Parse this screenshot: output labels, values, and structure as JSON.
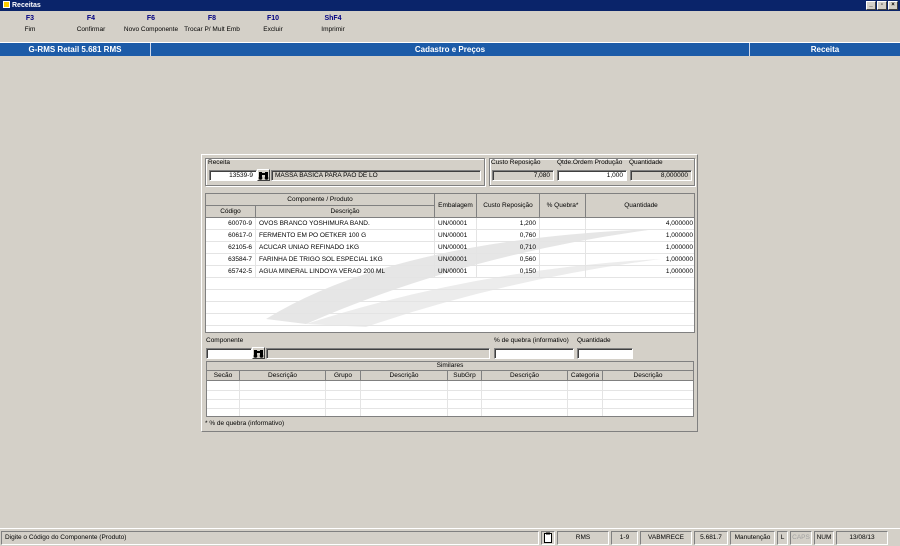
{
  "window": {
    "title": "Receitas",
    "icon": "app-icon"
  },
  "fkeys": [
    {
      "key": "F3",
      "label": "Fim"
    },
    {
      "key": "F4",
      "label": "Confirmar"
    },
    {
      "key": "F6",
      "label": "Novo Componente"
    },
    {
      "key": "F8",
      "label": "Trocar P/ Mult Emb"
    },
    {
      "key": "F10",
      "label": "Excluir"
    },
    {
      "key": "ShF4",
      "label": "Imprimir"
    }
  ],
  "header": {
    "app": "G-RMS Retail 5.681 RMS",
    "module": "Cadastro e Preços",
    "screen": "Receita",
    "color": "#1c5ba8"
  },
  "receita": {
    "label": "Receita",
    "code": "13539-9",
    "description": "MASSA BASICA PARA PAO DE LO",
    "custo_label": "Custo Reposição",
    "custo": "7,080",
    "qtde_label": "Qtde.Ordem Produção",
    "qtde": "1,000",
    "quantidade_label": "Quantidade",
    "quantidade": "8,000000"
  },
  "table": {
    "group_header": "Componente / Produto",
    "columns": {
      "codigo": "Código",
      "descricao": "Descrição",
      "embalagem": "Embalagem",
      "custo": "Custo Reposição",
      "quebra": "% Quebra*",
      "quantidade": "Quantidade"
    },
    "rows": [
      {
        "codigo": "60070-9",
        "descricao": "OVOS BRANCO YOSHIMURA BAND.",
        "embalagem": "UN/00001",
        "custo": "1,200",
        "quebra": "",
        "quantidade": "4,000000"
      },
      {
        "codigo": "60617-0",
        "descricao": "FERMENTO EM PO OETKER 100 G",
        "embalagem": "UN/00001",
        "custo": "0,760",
        "quebra": "",
        "quantidade": "1,000000"
      },
      {
        "codigo": "62105-6",
        "descricao": "ACUCAR UNIAO REFINADO 1KG",
        "embalagem": "UN/00001",
        "custo": "0,710",
        "quebra": "",
        "quantidade": "1,000000"
      },
      {
        "codigo": "63584-7",
        "descricao": "FARINHA DE TRIGO SOL ESPECIAL 1KG",
        "embalagem": "UN/00001",
        "custo": "0,560",
        "quebra": "",
        "quantidade": "1,000000"
      },
      {
        "codigo": "65742-5",
        "descricao": "AGUA MINERAL LINDOYA VERAO 200 ML",
        "embalagem": "UN/00001",
        "custo": "0,150",
        "quebra": "",
        "quantidade": "1,000000"
      }
    ]
  },
  "componente": {
    "label": "Componente",
    "code": "",
    "description": "",
    "quebra_label": "% de quebra (informativo)",
    "quebra": "",
    "quantidade_label": "Quantidade",
    "quantidade": ""
  },
  "similares": {
    "title": "Similares",
    "columns": [
      "Secão",
      "Descrição",
      "Grupo",
      "Descrição",
      "SubGrp",
      "Descrição",
      "Categoria",
      "Descrição"
    ]
  },
  "note": "* % de quebra (informativo)",
  "status": {
    "message": "Digite o Código do Componente (Produto)",
    "items": [
      "RMS",
      "1-9",
      "VABMRECE",
      "5.681.7",
      "Manutenção",
      "L",
      "CAPS",
      "NUM",
      "13/08/13"
    ]
  }
}
